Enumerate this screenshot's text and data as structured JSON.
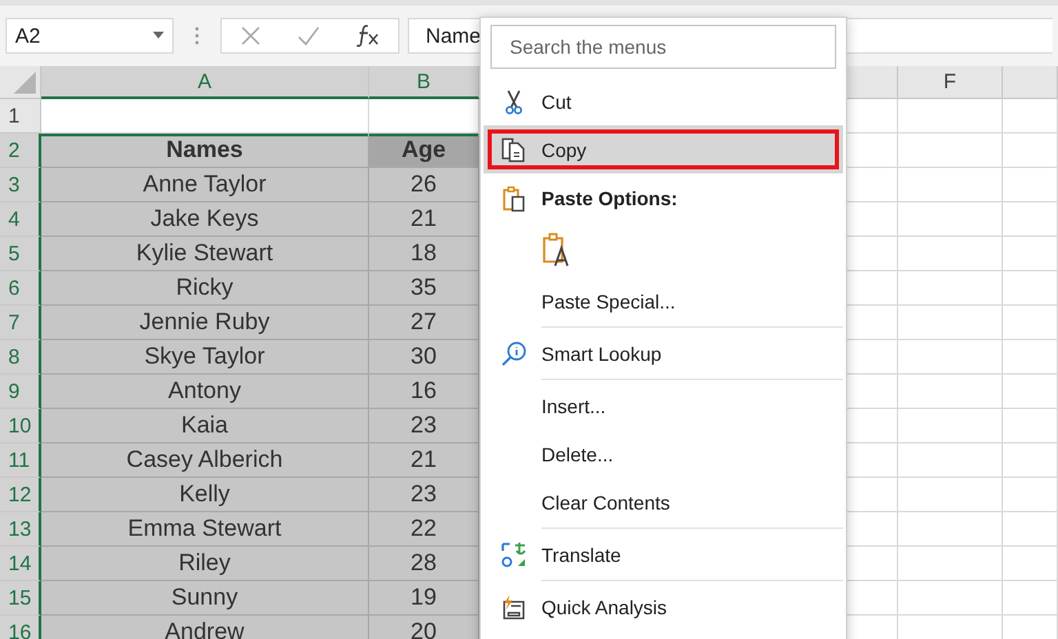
{
  "name_box": {
    "value": "A2"
  },
  "formula_bar": {
    "value": "Name"
  },
  "columns": [
    {
      "label": "A",
      "selected": true
    },
    {
      "label": "B",
      "selected": true
    },
    {
      "label": "F",
      "selected": false
    }
  ],
  "rows": [
    {
      "number": "1",
      "selected": false,
      "kind": "plain",
      "cells": []
    },
    {
      "number": "2",
      "selected": true,
      "kind": "header",
      "cells": [
        "Names",
        "Age"
      ]
    },
    {
      "number": "3",
      "selected": true,
      "kind": "plain",
      "cells": [
        "Anne Taylor",
        "26"
      ]
    },
    {
      "number": "4",
      "selected": true,
      "kind": "plain",
      "cells": [
        "Jake Keys",
        "21"
      ]
    },
    {
      "number": "5",
      "selected": true,
      "kind": "plain",
      "cells": [
        "Kylie Stewart",
        "18"
      ]
    },
    {
      "number": "6",
      "selected": true,
      "kind": "plain",
      "cells": [
        "Ricky",
        "35"
      ]
    },
    {
      "number": "7",
      "selected": true,
      "kind": "plain",
      "cells": [
        "Jennie Ruby",
        "27"
      ]
    },
    {
      "number": "8",
      "selected": true,
      "kind": "plain",
      "cells": [
        "Skye Taylor",
        "30"
      ]
    },
    {
      "number": "9",
      "selected": true,
      "kind": "plain",
      "cells": [
        "Antony",
        "16"
      ]
    },
    {
      "number": "10",
      "selected": true,
      "kind": "plain",
      "cells": [
        "Kaia",
        "23"
      ]
    },
    {
      "number": "11",
      "selected": true,
      "kind": "plain",
      "cells": [
        "Casey Alberich",
        "21"
      ]
    },
    {
      "number": "12",
      "selected": true,
      "kind": "plain",
      "cells": [
        "Kelly",
        "23"
      ]
    },
    {
      "number": "13",
      "selected": true,
      "kind": "plain",
      "cells": [
        "Emma Stewart",
        "22"
      ]
    },
    {
      "number": "14",
      "selected": true,
      "kind": "plain",
      "cells": [
        "Riley",
        "28"
      ]
    },
    {
      "number": "15",
      "selected": true,
      "kind": "plain",
      "cells": [
        "Sunny",
        "19"
      ]
    },
    {
      "number": "16",
      "selected": true,
      "kind": "plain",
      "cells": [
        "Andrew",
        "20"
      ]
    }
  ],
  "context_menu": {
    "search": {
      "placeholder": "Search the menus"
    },
    "items": [
      {
        "kind": "command",
        "label": "Cut",
        "selected": false
      },
      {
        "kind": "command",
        "label": "Copy",
        "selected": true
      },
      {
        "kind": "heading",
        "label": "Paste Options:"
      },
      {
        "kind": "paste-buttons"
      },
      {
        "kind": "command",
        "label": "Paste Special...",
        "selected": false
      },
      {
        "kind": "separator"
      },
      {
        "kind": "command",
        "label": "Smart Lookup",
        "selected": false
      },
      {
        "kind": "separator"
      },
      {
        "kind": "command",
        "label": "Insert...",
        "selected": false
      },
      {
        "kind": "command",
        "label": "Delete...",
        "selected": false
      },
      {
        "kind": "command",
        "label": "Clear Contents",
        "selected": false
      },
      {
        "kind": "separator"
      },
      {
        "kind": "command",
        "label": "Translate",
        "selected": false
      },
      {
        "kind": "separator"
      },
      {
        "kind": "command",
        "label": "Quick Analysis",
        "selected": false
      }
    ]
  }
}
